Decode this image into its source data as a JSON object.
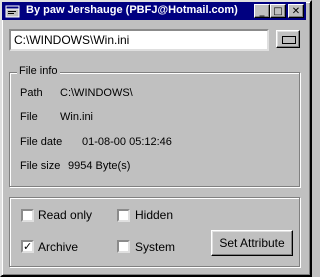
{
  "window": {
    "title": "By paw Jershauge (PBFJ@Hotmail.com)",
    "icon": "app-window-icon",
    "title_color": "#000080",
    "controls": {
      "minimize": "_",
      "maximize": "□",
      "close": "✕"
    }
  },
  "path_input": {
    "value": "C:\\WINDOWS\\Win.ini"
  },
  "browse_button": {
    "icon": "ellipsis-button-icon"
  },
  "file_info": {
    "label": "File info",
    "rows": [
      {
        "label": "Path",
        "value": "C:\\WINDOWS\\"
      },
      {
        "label": "File",
        "value": "Win.ini"
      },
      {
        "label": "File date",
        "value": "01-08-00 05:12:46"
      },
      {
        "label": "File size",
        "value": "9954 Byte(s)"
      }
    ]
  },
  "attributes": {
    "read_only": {
      "label": "Read only",
      "checked": false
    },
    "hidden": {
      "label": "Hidden",
      "checked": false
    },
    "archive": {
      "label": "Archive",
      "checked": true,
      "mark": "✓"
    },
    "system": {
      "label": "System",
      "checked": false
    },
    "set_button": "Set Attribute"
  }
}
